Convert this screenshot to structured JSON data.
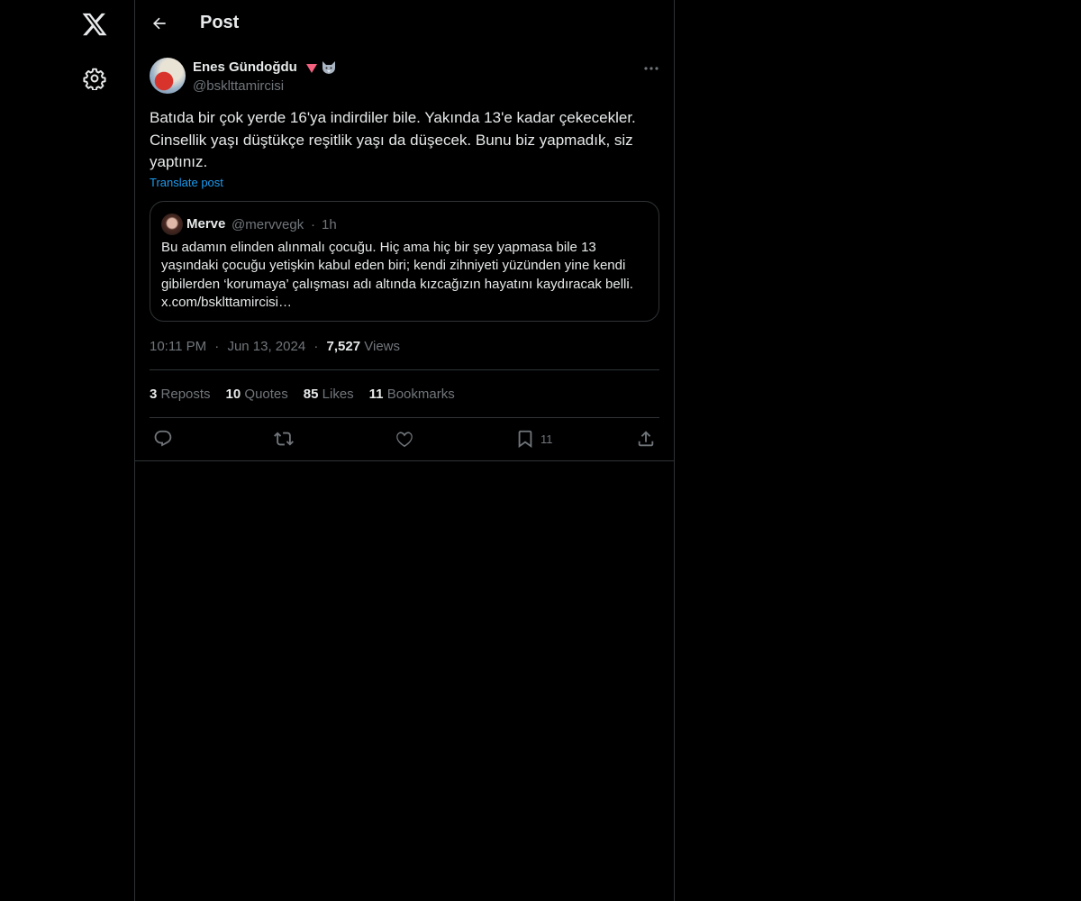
{
  "header": {
    "title": "Post"
  },
  "post": {
    "author_name": "Enes Gündoğdu",
    "author_handle": "@bsklttamircisi",
    "text": "Batıda bir çok yerde 16'ya indirdiler bile. Yakında 13'e kadar çekecekler. Cinsellik yaşı düştükçe reşitlik yaşı da düşecek. Bunu biz yapmadık, siz yaptınız.",
    "translate_label": "Translate post",
    "time": "10:11 PM",
    "date": "Jun 13, 2024",
    "separator": "·",
    "views_count": "7,527",
    "views_label": "Views"
  },
  "quote": {
    "name": "Merve",
    "handle": "@mervvegk",
    "separator": "·",
    "time": "1h",
    "text": "Bu adamın elinden alınmalı çocuğu. Hiç ama hiç bir şey yapmasa bile 13 yaşındaki çocuğu yetişkin kabul eden biri; kendi zihniyeti yüzünden yine kendi gibilerden ‘korumaya’ çalışması adı altında kızcağızın hayatını kaydıracak belli. x.com/bsklttamircisi…"
  },
  "stats": [
    {
      "count": "3",
      "label": "Reposts"
    },
    {
      "count": "10",
      "label": "Quotes"
    },
    {
      "count": "85",
      "label": "Likes"
    },
    {
      "count": "11",
      "label": "Bookmarks"
    }
  ],
  "actions": {
    "bookmark_count": "11"
  },
  "icons": {
    "logo": "x-logo-icon",
    "settings": "gear-icon",
    "back": "arrow-left-icon",
    "more": "more-horizontal-icon",
    "reply": "reply-icon",
    "repost": "repost-icon",
    "like": "heart-icon",
    "bookmark": "bookmark-icon",
    "share": "share-icon"
  },
  "colors": {
    "background": "#000000",
    "text_primary": "#e7e9ea",
    "text_secondary": "#71767b",
    "link": "#1d9bf0",
    "border": "#2f3336",
    "badge_heart": "#f4617f"
  }
}
